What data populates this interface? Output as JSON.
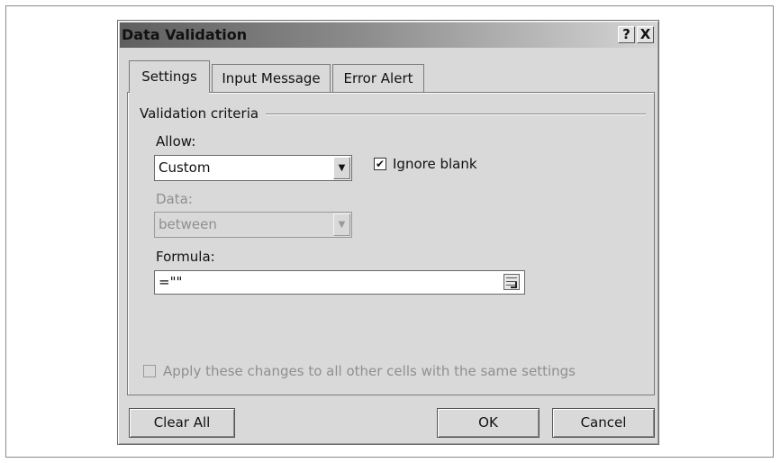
{
  "dialog": {
    "title": "Data Validation",
    "help_button": "?",
    "close_button": "X"
  },
  "tabs": [
    {
      "label": "Settings",
      "active": true
    },
    {
      "label": "Input Message",
      "active": false
    },
    {
      "label": "Error Alert",
      "active": false
    }
  ],
  "settings": {
    "section_label": "Validation criteria",
    "allow_label": "Allow:",
    "allow_value": "Custom",
    "ignore_blank_label": "Ignore blank",
    "ignore_blank_checked": true,
    "data_label": "Data:",
    "data_value": "between",
    "data_enabled": false,
    "formula_label": "Formula:",
    "formula_value": "=\"\"",
    "apply_all_label": "Apply these changes to all other cells with the same settings",
    "apply_all_checked": false
  },
  "buttons": {
    "clear_all": "Clear All",
    "ok": "OK",
    "cancel": "Cancel"
  }
}
